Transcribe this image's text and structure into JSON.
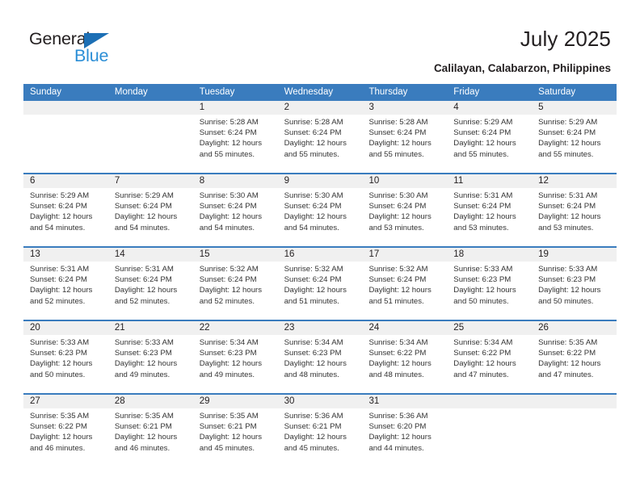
{
  "logo": {
    "word_top": "General",
    "word_bottom": "Blue",
    "triangle": "blue-triangle-icon",
    "brand_blue": "#2b8ed6",
    "triangle_blue": "#1c6fb5"
  },
  "header": {
    "title": "July 2025",
    "subtitle": "Calilayan, Calabarzon, Philippines"
  },
  "colors": {
    "header_blue": "#3a7cbe",
    "daynum_band": "#f0f0f0",
    "text": "#231f20"
  },
  "calendar": {
    "weekdays": [
      "Sunday",
      "Monday",
      "Tuesday",
      "Wednesday",
      "Thursday",
      "Friday",
      "Saturday"
    ],
    "weeks": [
      [
        {
          "day": "",
          "sunrise": "",
          "sunset": "",
          "daylight_line1": "",
          "daylight_line2": ""
        },
        {
          "day": "",
          "sunrise": "",
          "sunset": "",
          "daylight_line1": "",
          "daylight_line2": ""
        },
        {
          "day": "1",
          "sunrise": "Sunrise: 5:28 AM",
          "sunset": "Sunset: 6:24 PM",
          "daylight_line1": "Daylight: 12 hours",
          "daylight_line2": "and 55 minutes."
        },
        {
          "day": "2",
          "sunrise": "Sunrise: 5:28 AM",
          "sunset": "Sunset: 6:24 PM",
          "daylight_line1": "Daylight: 12 hours",
          "daylight_line2": "and 55 minutes."
        },
        {
          "day": "3",
          "sunrise": "Sunrise: 5:28 AM",
          "sunset": "Sunset: 6:24 PM",
          "daylight_line1": "Daylight: 12 hours",
          "daylight_line2": "and 55 minutes."
        },
        {
          "day": "4",
          "sunrise": "Sunrise: 5:29 AM",
          "sunset": "Sunset: 6:24 PM",
          "daylight_line1": "Daylight: 12 hours",
          "daylight_line2": "and 55 minutes."
        },
        {
          "day": "5",
          "sunrise": "Sunrise: 5:29 AM",
          "sunset": "Sunset: 6:24 PM",
          "daylight_line1": "Daylight: 12 hours",
          "daylight_line2": "and 55 minutes."
        }
      ],
      [
        {
          "day": "6",
          "sunrise": "Sunrise: 5:29 AM",
          "sunset": "Sunset: 6:24 PM",
          "daylight_line1": "Daylight: 12 hours",
          "daylight_line2": "and 54 minutes."
        },
        {
          "day": "7",
          "sunrise": "Sunrise: 5:29 AM",
          "sunset": "Sunset: 6:24 PM",
          "daylight_line1": "Daylight: 12 hours",
          "daylight_line2": "and 54 minutes."
        },
        {
          "day": "8",
          "sunrise": "Sunrise: 5:30 AM",
          "sunset": "Sunset: 6:24 PM",
          "daylight_line1": "Daylight: 12 hours",
          "daylight_line2": "and 54 minutes."
        },
        {
          "day": "9",
          "sunrise": "Sunrise: 5:30 AM",
          "sunset": "Sunset: 6:24 PM",
          "daylight_line1": "Daylight: 12 hours",
          "daylight_line2": "and 54 minutes."
        },
        {
          "day": "10",
          "sunrise": "Sunrise: 5:30 AM",
          "sunset": "Sunset: 6:24 PM",
          "daylight_line1": "Daylight: 12 hours",
          "daylight_line2": "and 53 minutes."
        },
        {
          "day": "11",
          "sunrise": "Sunrise: 5:31 AM",
          "sunset": "Sunset: 6:24 PM",
          "daylight_line1": "Daylight: 12 hours",
          "daylight_line2": "and 53 minutes."
        },
        {
          "day": "12",
          "sunrise": "Sunrise: 5:31 AM",
          "sunset": "Sunset: 6:24 PM",
          "daylight_line1": "Daylight: 12 hours",
          "daylight_line2": "and 53 minutes."
        }
      ],
      [
        {
          "day": "13",
          "sunrise": "Sunrise: 5:31 AM",
          "sunset": "Sunset: 6:24 PM",
          "daylight_line1": "Daylight: 12 hours",
          "daylight_line2": "and 52 minutes."
        },
        {
          "day": "14",
          "sunrise": "Sunrise: 5:31 AM",
          "sunset": "Sunset: 6:24 PM",
          "daylight_line1": "Daylight: 12 hours",
          "daylight_line2": "and 52 minutes."
        },
        {
          "day": "15",
          "sunrise": "Sunrise: 5:32 AM",
          "sunset": "Sunset: 6:24 PM",
          "daylight_line1": "Daylight: 12 hours",
          "daylight_line2": "and 52 minutes."
        },
        {
          "day": "16",
          "sunrise": "Sunrise: 5:32 AM",
          "sunset": "Sunset: 6:24 PM",
          "daylight_line1": "Daylight: 12 hours",
          "daylight_line2": "and 51 minutes."
        },
        {
          "day": "17",
          "sunrise": "Sunrise: 5:32 AM",
          "sunset": "Sunset: 6:24 PM",
          "daylight_line1": "Daylight: 12 hours",
          "daylight_line2": "and 51 minutes."
        },
        {
          "day": "18",
          "sunrise": "Sunrise: 5:33 AM",
          "sunset": "Sunset: 6:23 PM",
          "daylight_line1": "Daylight: 12 hours",
          "daylight_line2": "and 50 minutes."
        },
        {
          "day": "19",
          "sunrise": "Sunrise: 5:33 AM",
          "sunset": "Sunset: 6:23 PM",
          "daylight_line1": "Daylight: 12 hours",
          "daylight_line2": "and 50 minutes."
        }
      ],
      [
        {
          "day": "20",
          "sunrise": "Sunrise: 5:33 AM",
          "sunset": "Sunset: 6:23 PM",
          "daylight_line1": "Daylight: 12 hours",
          "daylight_line2": "and 50 minutes."
        },
        {
          "day": "21",
          "sunrise": "Sunrise: 5:33 AM",
          "sunset": "Sunset: 6:23 PM",
          "daylight_line1": "Daylight: 12 hours",
          "daylight_line2": "and 49 minutes."
        },
        {
          "day": "22",
          "sunrise": "Sunrise: 5:34 AM",
          "sunset": "Sunset: 6:23 PM",
          "daylight_line1": "Daylight: 12 hours",
          "daylight_line2": "and 49 minutes."
        },
        {
          "day": "23",
          "sunrise": "Sunrise: 5:34 AM",
          "sunset": "Sunset: 6:23 PM",
          "daylight_line1": "Daylight: 12 hours",
          "daylight_line2": "and 48 minutes."
        },
        {
          "day": "24",
          "sunrise": "Sunrise: 5:34 AM",
          "sunset": "Sunset: 6:22 PM",
          "daylight_line1": "Daylight: 12 hours",
          "daylight_line2": "and 48 minutes."
        },
        {
          "day": "25",
          "sunrise": "Sunrise: 5:34 AM",
          "sunset": "Sunset: 6:22 PM",
          "daylight_line1": "Daylight: 12 hours",
          "daylight_line2": "and 47 minutes."
        },
        {
          "day": "26",
          "sunrise": "Sunrise: 5:35 AM",
          "sunset": "Sunset: 6:22 PM",
          "daylight_line1": "Daylight: 12 hours",
          "daylight_line2": "and 47 minutes."
        }
      ],
      [
        {
          "day": "27",
          "sunrise": "Sunrise: 5:35 AM",
          "sunset": "Sunset: 6:22 PM",
          "daylight_line1": "Daylight: 12 hours",
          "daylight_line2": "and 46 minutes."
        },
        {
          "day": "28",
          "sunrise": "Sunrise: 5:35 AM",
          "sunset": "Sunset: 6:21 PM",
          "daylight_line1": "Daylight: 12 hours",
          "daylight_line2": "and 46 minutes."
        },
        {
          "day": "29",
          "sunrise": "Sunrise: 5:35 AM",
          "sunset": "Sunset: 6:21 PM",
          "daylight_line1": "Daylight: 12 hours",
          "daylight_line2": "and 45 minutes."
        },
        {
          "day": "30",
          "sunrise": "Sunrise: 5:36 AM",
          "sunset": "Sunset: 6:21 PM",
          "daylight_line1": "Daylight: 12 hours",
          "daylight_line2": "and 45 minutes."
        },
        {
          "day": "31",
          "sunrise": "Sunrise: 5:36 AM",
          "sunset": "Sunset: 6:20 PM",
          "daylight_line1": "Daylight: 12 hours",
          "daylight_line2": "and 44 minutes."
        },
        {
          "day": "",
          "sunrise": "",
          "sunset": "",
          "daylight_line1": "",
          "daylight_line2": ""
        },
        {
          "day": "",
          "sunrise": "",
          "sunset": "",
          "daylight_line1": "",
          "daylight_line2": ""
        }
      ]
    ]
  }
}
